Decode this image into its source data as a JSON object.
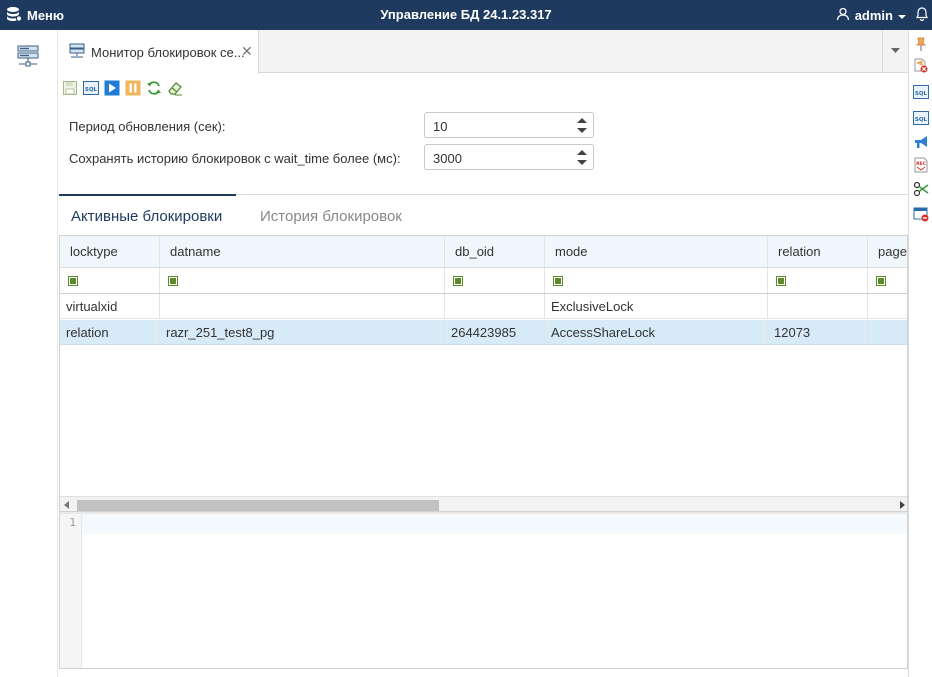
{
  "app": {
    "menu_label": "Меню",
    "title": "Управление БД 24.1.23.317",
    "user_name": "admin"
  },
  "tabs": [
    {
      "label": "Монитор блокировок се..."
    }
  ],
  "form": {
    "refresh_label": "Период обновления (сек):",
    "refresh_value": "10",
    "history_label": "Сохранять историю блокировок с wait_time более (мс):",
    "history_value": "3000"
  },
  "subtabs": {
    "active": "Активные блокировки",
    "history": "История блокировок"
  },
  "table": {
    "columns": [
      "locktype",
      "datname",
      "db_oid",
      "mode",
      "relation",
      "page"
    ],
    "rows": [
      [
        "virtualxid",
        "",
        "",
        "ExclusiveLock",
        "",
        ""
      ],
      [
        "relation",
        "razr_251_test8_pg",
        "264423985",
        "AccessShareLock",
        "12073",
        ""
      ]
    ],
    "selected_row": 1
  },
  "editor": {
    "line_number": "1"
  },
  "colors": {
    "topbar": "#1e3a5f",
    "accent": "#1e3a5f",
    "selected_row": "#d7eaf8",
    "filter_check": "#5c8a2b"
  },
  "icons": {
    "menu": "database-menu-icon",
    "user": "user-icon",
    "bell": "bell-icon",
    "save": "save-icon",
    "sql": "sql-icon",
    "play": "play-icon",
    "pause": "pause-icon",
    "refresh": "refresh-icon",
    "clear": "eraser-icon"
  }
}
